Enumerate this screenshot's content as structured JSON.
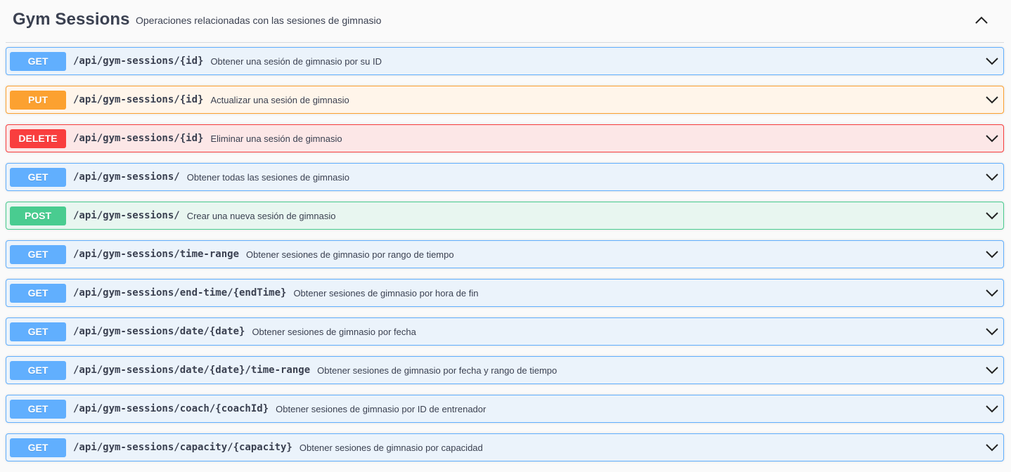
{
  "tag": {
    "title": "Gym Sessions",
    "description": "Operaciones relacionadas con las sesiones de gimnasio"
  },
  "operations": [
    {
      "method": "GET",
      "path": "/api/gym-sessions/{id}",
      "summary": "Obtener una sesión de gimnasio por su ID"
    },
    {
      "method": "PUT",
      "path": "/api/gym-sessions/{id}",
      "summary": "Actualizar una sesión de gimnasio"
    },
    {
      "method": "DELETE",
      "path": "/api/gym-sessions/{id}",
      "summary": "Eliminar una sesión de gimnasio"
    },
    {
      "method": "GET",
      "path": "/api/gym-sessions/",
      "summary": "Obtener todas las sesiones de gimnasio"
    },
    {
      "method": "POST",
      "path": "/api/gym-sessions/",
      "summary": "Crear una nueva sesión de gimnasio"
    },
    {
      "method": "GET",
      "path": "/api/gym-sessions/time-range",
      "summary": "Obtener sesiones de gimnasio por rango de tiempo"
    },
    {
      "method": "GET",
      "path": "/api/gym-sessions/end-time/{endTime}",
      "summary": "Obtener sesiones de gimnasio por hora de fin"
    },
    {
      "method": "GET",
      "path": "/api/gym-sessions/date/{date}",
      "summary": "Obtener sesiones de gimnasio por fecha"
    },
    {
      "method": "GET",
      "path": "/api/gym-sessions/date/{date}/time-range",
      "summary": "Obtener sesiones de gimnasio por fecha y rango de tiempo"
    },
    {
      "method": "GET",
      "path": "/api/gym-sessions/coach/{coachId}",
      "summary": "Obtener sesiones de gimnasio por ID de entrenador"
    },
    {
      "method": "GET",
      "path": "/api/gym-sessions/capacity/{capacity}",
      "summary": "Obtener sesiones de gimnasio por capacidad"
    }
  ],
  "icons": {
    "collapse": "chevron-up-icon",
    "expand": "chevron-down-icon"
  },
  "colors": {
    "get": "#61affe",
    "put": "#fca130",
    "delete": "#f93e3e",
    "post": "#49cc90",
    "text": "#3b4151"
  }
}
